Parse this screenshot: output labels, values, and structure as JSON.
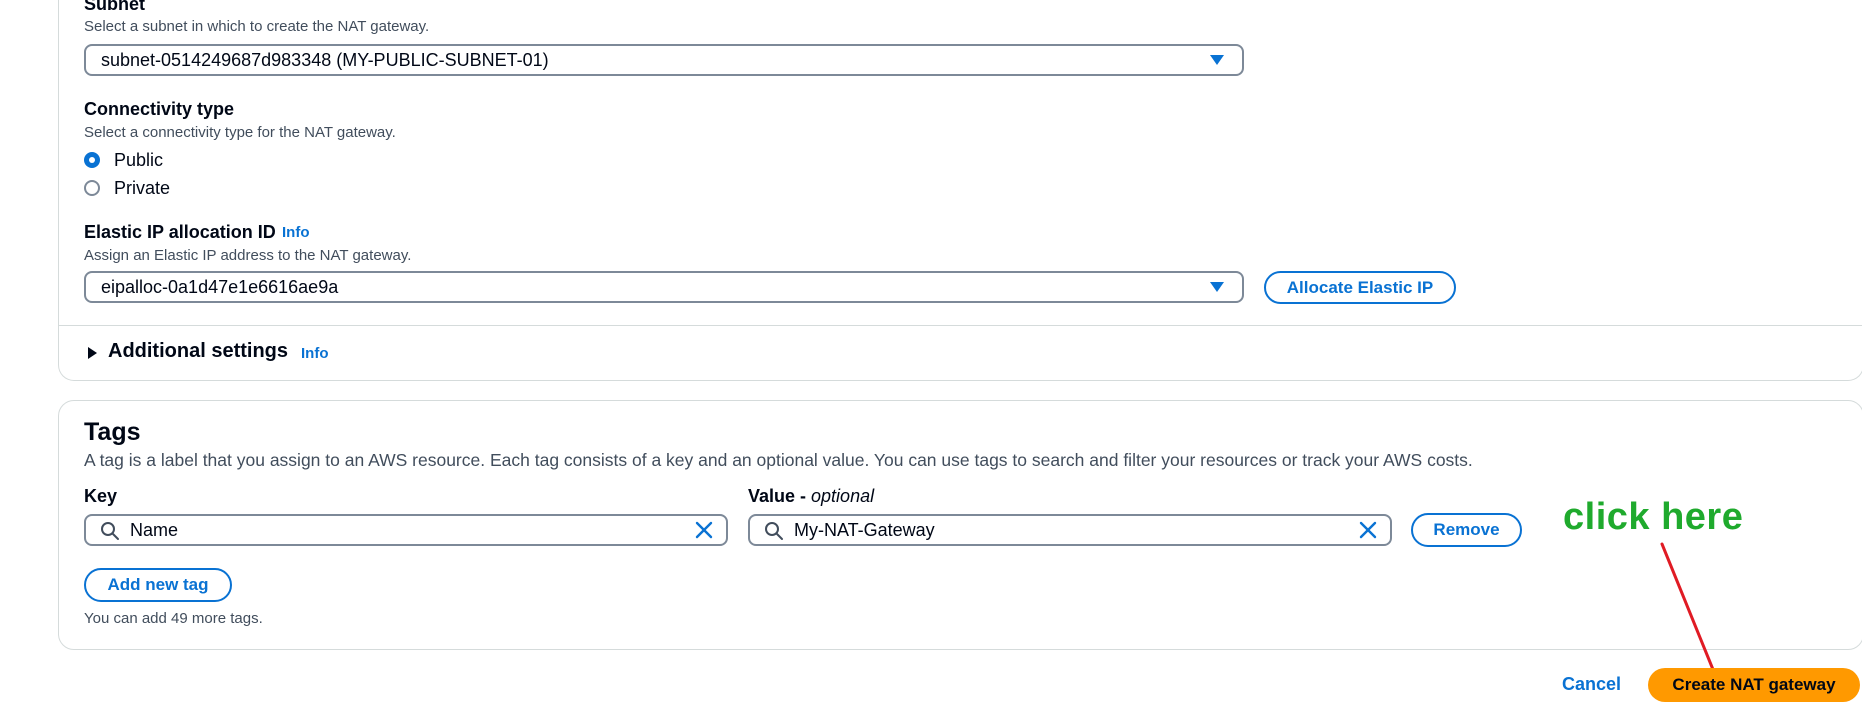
{
  "subnet": {
    "label": "Subnet",
    "description": "Select a subnet in which to create the NAT gateway.",
    "value": "subnet-0514249687d983348 (MY-PUBLIC-SUBNET-01)"
  },
  "connectivity": {
    "label": "Connectivity type",
    "description": "Select a connectivity type for the NAT gateway.",
    "options": [
      {
        "label": "Public",
        "selected": true
      },
      {
        "label": "Private",
        "selected": false
      }
    ]
  },
  "elastic_ip": {
    "label": "Elastic IP allocation ID",
    "info": "Info",
    "description": "Assign an Elastic IP address to the NAT gateway.",
    "value": "eipalloc-0a1d47e1e6616ae9a",
    "allocate_button": "Allocate Elastic IP"
  },
  "additional_settings": {
    "label": "Additional settings",
    "info": "Info"
  },
  "tags": {
    "title": "Tags",
    "description": "A tag is a label that you assign to an AWS resource. Each tag consists of a key and an optional value. You can use tags to search and filter your resources or track your AWS costs.",
    "key_label": "Key",
    "value_label": "Value - ",
    "value_optional": "optional",
    "rows": [
      {
        "key": "Name",
        "value": "My-NAT-Gateway",
        "remove_label": "Remove"
      }
    ],
    "add_button": "Add new tag",
    "remaining_note": "You can add 49 more tags."
  },
  "annotation": {
    "text": "click here",
    "color": "#1faa2d",
    "arrow_color": "#e01b24"
  },
  "footer": {
    "cancel_label": "Cancel",
    "create_label": "Create NAT gateway"
  },
  "colors": {
    "accent": "#0972d3",
    "primary_button": "#ff9900",
    "top_border": "#1d8102"
  },
  "icons": [
    "caret-down-icon",
    "search-icon",
    "clear-icon",
    "expand-triangle-icon"
  ]
}
